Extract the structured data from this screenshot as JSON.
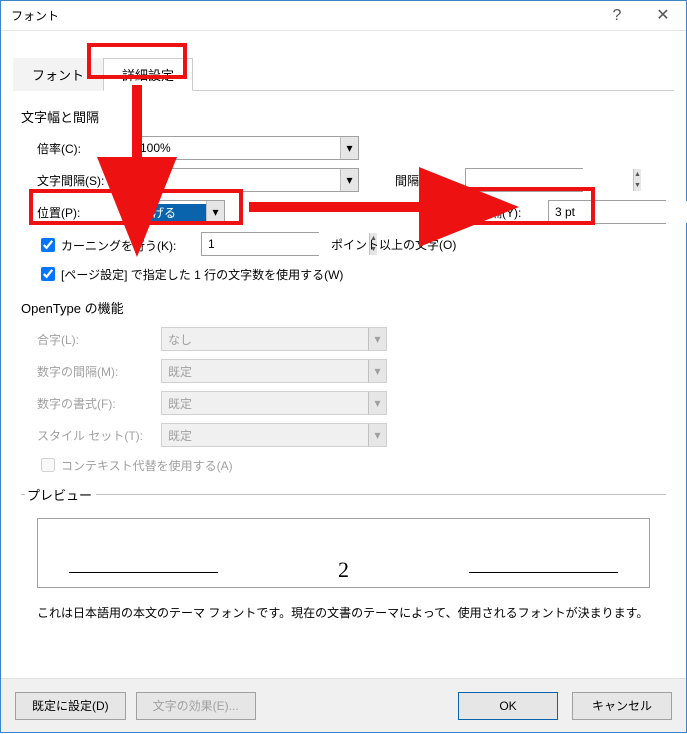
{
  "title": "フォント",
  "tabs": {
    "font": "フォント",
    "advanced": "詳細設定"
  },
  "section_spacing": "文字幅と間隔",
  "labels": {
    "scale": "倍率(C):",
    "spacing": "文字間隔(S):",
    "spacing_by": "間隔(B):",
    "position": "位置(P):",
    "position_by": "間隔(Y):",
    "kerning": "カーニングを行う(K):",
    "kerning_after": "ポイント以上の文字(O)",
    "pagesetup": "[ページ設定] で指定した 1 行の文字数を使用する(W)"
  },
  "values": {
    "scale": "100%",
    "spacing": "標準",
    "spacing_by": "",
    "position": "上げる",
    "position_by": "3 pt",
    "kerning": "1"
  },
  "section_opentype": "OpenType の機能",
  "ot_labels": {
    "ligatures": "合字(L):",
    "numspacing": "数字の間隔(M):",
    "numform": "数字の書式(F):",
    "styleset": "スタイル セット(T):",
    "context": "コンテキスト代替を使用する(A)"
  },
  "ot_values": {
    "ligatures": "なし",
    "numspacing": "既定",
    "numform": "既定",
    "styleset": "既定"
  },
  "preview": {
    "legend": "プレビュー",
    "sample": "2",
    "desc": "これは日本語用の本文のテーマ フォントです。現在の文書のテーマによって、使用されるフォントが決まります。"
  },
  "buttons": {
    "setdefault": "既定に設定(D)",
    "texteffects": "文字の効果(E)...",
    "ok": "OK",
    "cancel": "キャンセル"
  }
}
